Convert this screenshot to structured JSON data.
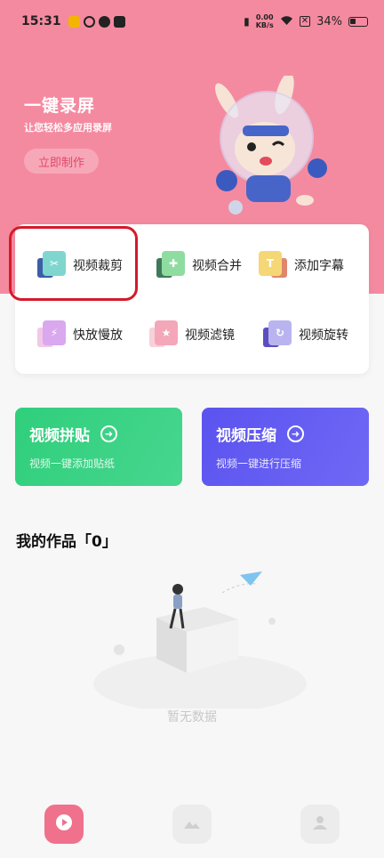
{
  "status_bar": {
    "time": "15:31",
    "net_speed_value": "0.00",
    "net_speed_unit": "KB/s",
    "battery": "34%"
  },
  "hero": {
    "title": "一键录屏",
    "subtitle": "让您轻松多应用录屏",
    "cta_label": "立即制作"
  },
  "tools": [
    {
      "label": "视频裁剪",
      "icon": "scissors-icon",
      "color": "#7fd6cf",
      "back": "#3b5ea6"
    },
    {
      "label": "视频合并",
      "icon": "puzzle-icon",
      "color": "#8fdca0",
      "back": "#3e7a5a"
    },
    {
      "label": "添加字幕",
      "icon": "text-icon",
      "color": "#f6d776",
      "back": "#e1866e"
    },
    {
      "label": "快放慢放",
      "icon": "lightning-icon",
      "color": "#d9a8ee",
      "back": "#f2c7e7"
    },
    {
      "label": "视频滤镜",
      "icon": "sparkle-icon",
      "color": "#f4a7b9",
      "back": "#f7d1d9"
    },
    {
      "label": "视频旋转",
      "icon": "rotate-icon",
      "color": "#b9b4f0",
      "back": "#5b4fbf"
    }
  ],
  "feature_cards": [
    {
      "title": "视频拼贴",
      "subtitle": "视频一键添加贴纸",
      "color1": "#2fcf7c",
      "color2": "#47d68e"
    },
    {
      "title": "视频压缩",
      "subtitle": "视频一键进行压缩",
      "color1": "#5b53ef",
      "color2": "#6f68f5"
    }
  ],
  "my_works": {
    "title": "我的作品「0」",
    "empty_text": "暂无数据"
  },
  "tabbar": {
    "items": [
      {
        "icon": "video-home-icon",
        "active": true
      },
      {
        "icon": "gallery-icon",
        "active": false
      },
      {
        "icon": "profile-icon",
        "active": false
      }
    ]
  },
  "colors": {
    "hero_bg": "#f48aa0",
    "highlight_border": "#d41a2a",
    "active_tab": "#f0718c"
  }
}
